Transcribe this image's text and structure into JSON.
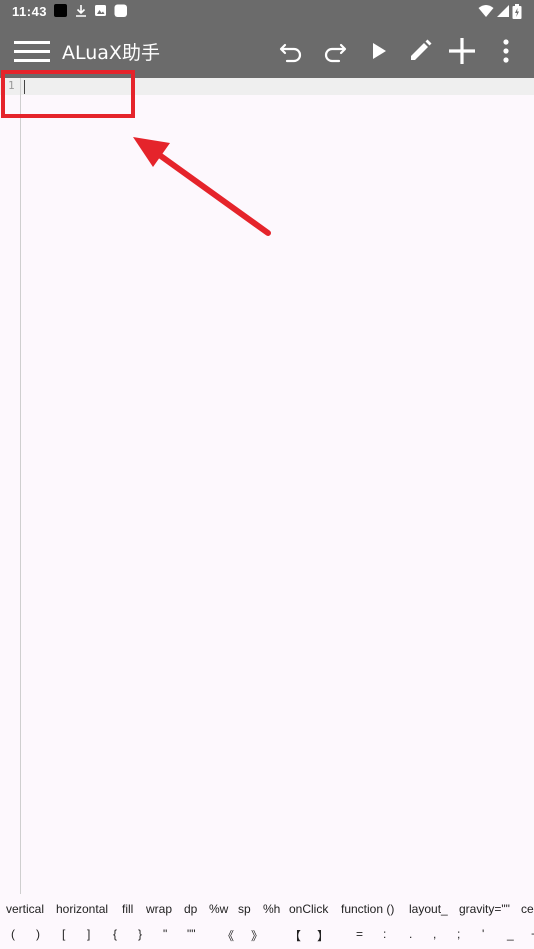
{
  "status_bar": {
    "time": "11:43",
    "left_icons": [
      "app-notification-icon",
      "download-icon",
      "photo-icon",
      "app-square-icon"
    ],
    "right_icons": [
      "wifi-icon",
      "signal-icon",
      "battery-icon"
    ]
  },
  "app_bar": {
    "title": "ALuaX助手",
    "actions": [
      "undo-icon",
      "redo-icon",
      "run-icon",
      "edit-icon",
      "add-icon",
      "more-vert-icon"
    ]
  },
  "editor": {
    "line_numbers": [
      "1"
    ],
    "content": ""
  },
  "symbol_bar": {
    "row1": [
      "vertical",
      "horizontal",
      "fill",
      "wrap",
      "dp",
      "%w",
      "sp",
      "%h",
      "onClick",
      "function ()",
      "layout_",
      "gravity=\"\"",
      "ce"
    ],
    "row2": [
      "(",
      ")",
      "[",
      "]",
      "{",
      "}",
      "\"",
      "\"\"",
      "《",
      "》",
      "【",
      "】",
      "=",
      ":",
      ".",
      ",",
      ";",
      "'",
      "_",
      "+"
    ]
  },
  "annotation": {
    "color": "#e5242b"
  },
  "colors": {
    "toolbar": "#6b6b6b",
    "editor_bg": "#fdf8fd",
    "current_line": "#efefef"
  }
}
